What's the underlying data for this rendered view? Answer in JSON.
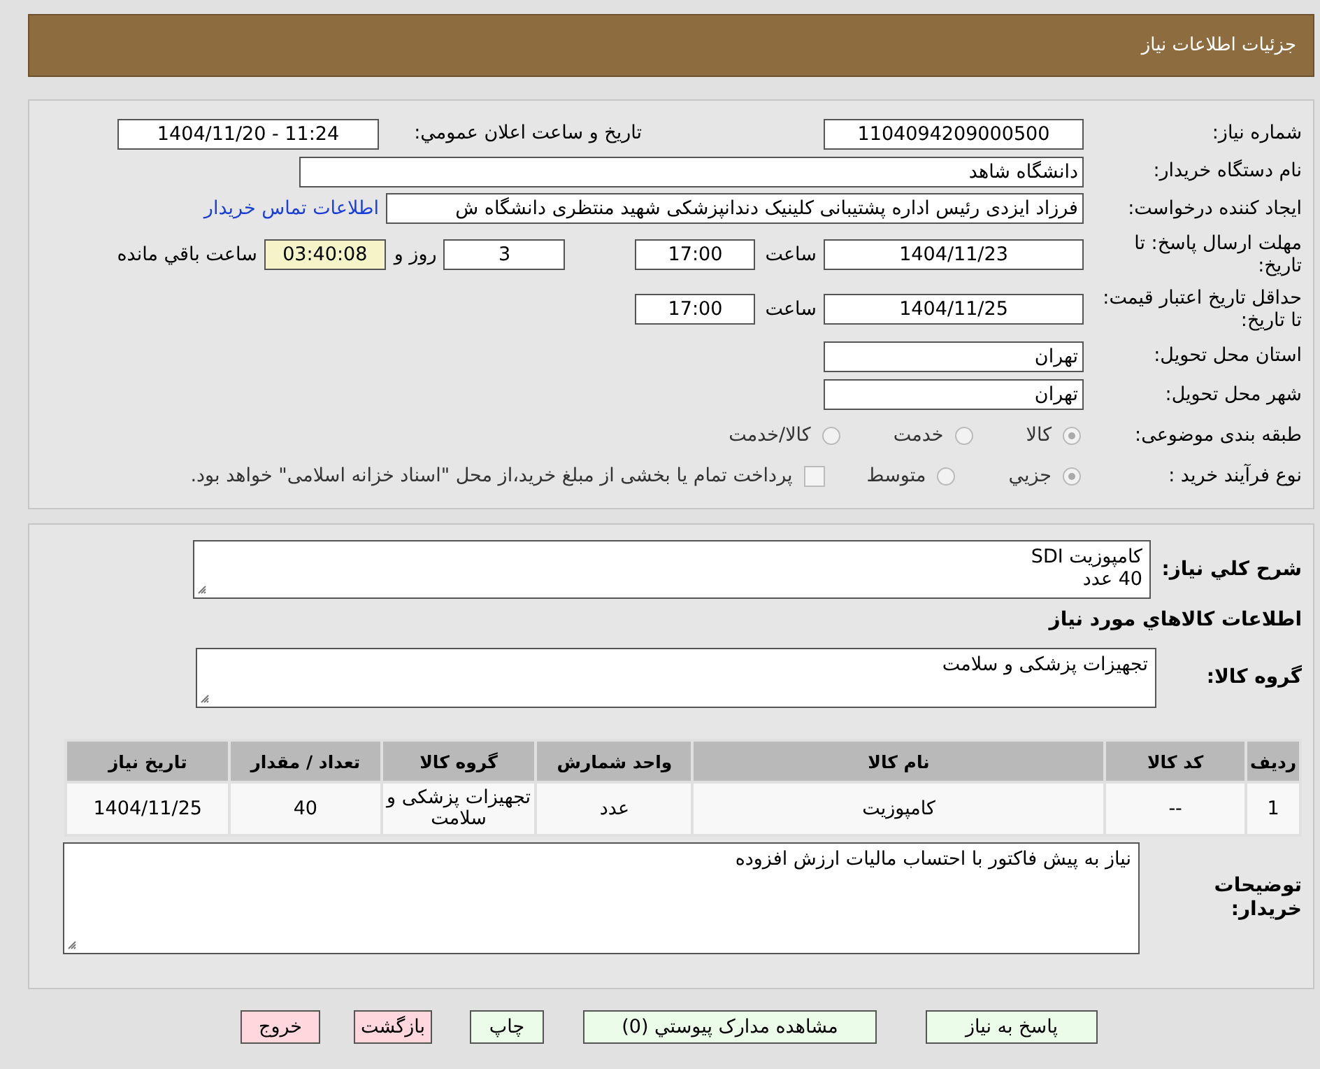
{
  "header": {
    "title": "جزئیات اطلاعات نیاز"
  },
  "details": {
    "need_number": {
      "label": "شماره نیاز:",
      "value": "1104094209000500"
    },
    "announce": {
      "label": "تاریخ و ساعت اعلان عمومي:",
      "value": "1404/11/20 - 11:24"
    },
    "buyer": {
      "label": "نام دستگاه خریدار:",
      "value": "دانشگاه شاهد"
    },
    "requester": {
      "label": "ایجاد کننده درخواست:",
      "value": "فرزاد ایزدی رئیس اداره پشتیبانی کلینیک دندانپزشکی شهید منتظری دانشگاه ش",
      "link": "اطلاعات تماس خریدار"
    },
    "deadline": {
      "label": "مهلت ارسال پاسخ: تا تاریخ:",
      "date": "1404/11/23",
      "time_label": "ساعت",
      "time": "17:00",
      "days": "3",
      "days_label": "روز و",
      "remaining": "03:40:08",
      "remaining_label": "ساعت باقي مانده"
    },
    "validity": {
      "label": "حداقل تاریخ اعتبار قیمت: تا تاریخ:",
      "date": "1404/11/25",
      "time_label": "ساعت",
      "time": "17:00"
    },
    "province": {
      "label": "استان محل تحویل:",
      "value": "تهران"
    },
    "city": {
      "label": "شهر محل تحویل:",
      "value": "تهران"
    },
    "category": {
      "label": "طبقه بندی موضوعی:",
      "options": [
        {
          "label": "کالا",
          "selected": true
        },
        {
          "label": "خدمت",
          "selected": false
        },
        {
          "label": "کالا/خدمت",
          "selected": false
        }
      ]
    },
    "process": {
      "label": "نوع فرآیند خرید :",
      "options": [
        {
          "label": "جزيي",
          "selected": true
        },
        {
          "label": "متوسط",
          "selected": false
        }
      ],
      "payment": {
        "checked": false,
        "text": "پرداخت تمام یا بخشی از مبلغ خرید،از محل \"اسناد خزانه اسلامی\" خواهد بود."
      }
    }
  },
  "needs": {
    "description": {
      "label": "شرح کلي نیاز:",
      "lines": [
        "کامپوزیت SDI",
        "40 عدد"
      ]
    },
    "heading": "اطلاعات کالاهاي مورد نیاز",
    "group": {
      "label": "گروه کالا:",
      "value": "تجهیزات پزشکی و سلامت"
    },
    "table": {
      "columns": [
        "ردیف",
        "کد کالا",
        "نام کالا",
        "واحد شمارش",
        "گروه کالا",
        "تعداد / مقدار",
        "تاریخ نیاز"
      ],
      "rows": [
        [
          "1",
          "--",
          "کامپوزیت",
          "عدد",
          "تجهیزات پزشکی و سلامت",
          "40",
          "1404/11/25"
        ]
      ]
    },
    "notes": {
      "label": "توضیحات خریدار:",
      "value": "نیاز به پیش فاکتور با احتساب مالیات ارزش افزوده"
    }
  },
  "buttons": [
    {
      "label": "پاسخ به نیاز",
      "kind": "primary"
    },
    {
      "label": "مشاهده مدارک پیوستي (0)",
      "kind": "primary"
    },
    {
      "label": "چاپ",
      "kind": "primary"
    },
    {
      "label": "بازگشت",
      "kind": "danger"
    },
    {
      "label": "خروج",
      "kind": "danger"
    }
  ]
}
